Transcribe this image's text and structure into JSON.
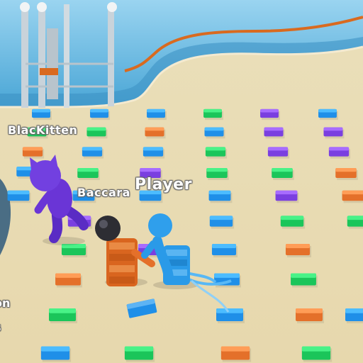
{
  "players": {
    "bot_1": {
      "name": "BlacKitten",
      "color": "#6a35d6"
    },
    "bot_2": {
      "name": "Baccara",
      "color": "#e0772a"
    },
    "user": {
      "name": "Player",
      "color": "#2a9ae8"
    },
    "edge_tag_1": "on",
    "edge_tag_2": "s"
  },
  "colors": {
    "floor": "#e9dcb4",
    "pool": "#5fb6df",
    "pool_rim": "#d96a1f",
    "brick_blue": "#1f8fe8",
    "brick_orange": "#e4702a",
    "brick_green": "#1bc55a",
    "brick_purple": "#7a3fe0"
  }
}
